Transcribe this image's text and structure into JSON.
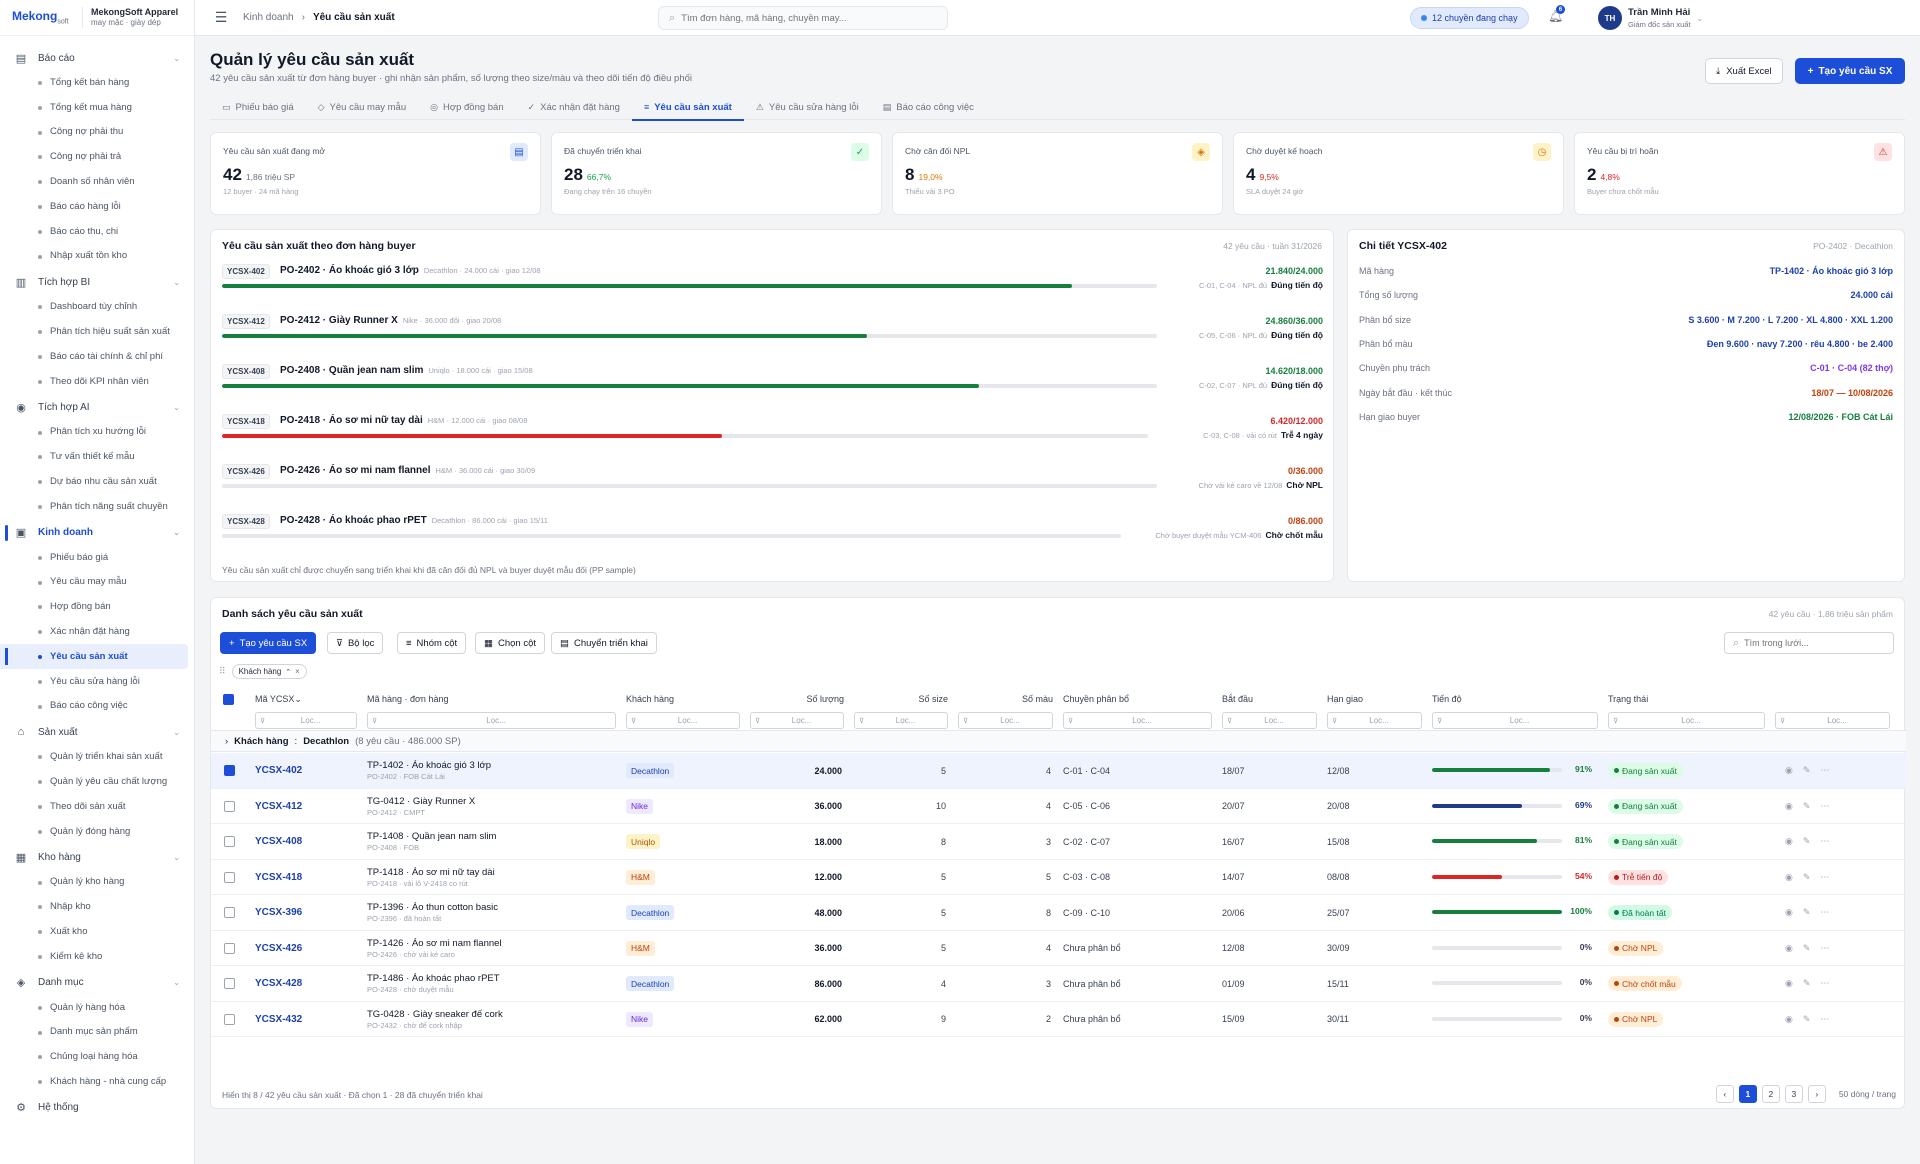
{
  "brand": {
    "logo": "Mekong",
    "logo_sub": "soft",
    "company": "MekongSoft Apparel",
    "tagline": "may mặc · giày dép"
  },
  "sidebar": {
    "groups": [
      {
        "label": "Báo cáo",
        "icon": "report-icon",
        "items": [
          "Tổng kết bán hàng",
          "Tổng kết mua hàng",
          "Công nợ phải thu",
          "Công nợ phải trả",
          "Doanh số nhân viên",
          "Báo cáo hàng lỗi",
          "Báo cáo thu, chi",
          "Nhập xuất tồn kho"
        ]
      },
      {
        "label": "Tích hợp BI",
        "icon": "chart-icon",
        "items": [
          "Dashboard tùy chỉnh",
          "Phân tích hiệu suất sản xuất",
          "Báo cáo tài chính & chỉ phí",
          "Theo dõi KPI nhân viên"
        ]
      },
      {
        "label": "Tích hợp AI",
        "icon": "ai-icon",
        "items": [
          "Phân tích xu hướng lỗi",
          "Tư vấn thiết kế mẫu",
          "Dự báo nhu cầu sản xuất",
          "Phân tích năng suất chuyền"
        ]
      },
      {
        "label": "Kinh doanh",
        "icon": "business-icon",
        "active": true,
        "items": [
          "Phiếu báo giá",
          "Yêu cầu may mẫu",
          "Hợp đồng bán",
          "Xác nhận đặt hàng",
          "Yêu cầu sản xuất",
          "Yêu cầu sửa hàng lỗi",
          "Báo cáo công việc"
        ],
        "active_item": 4
      },
      {
        "label": "Sản xuất",
        "icon": "factory-icon",
        "items": [
          "Quản lý triển khai sản xuất",
          "Quản lý yêu cầu chất lượng",
          "Theo dõi sản xuất",
          "Quản lý đóng hàng"
        ]
      },
      {
        "label": "Kho hàng",
        "icon": "warehouse-icon",
        "items": [
          "Quản lý kho hàng",
          "Nhập kho",
          "Xuất kho",
          "Kiểm kê kho"
        ]
      },
      {
        "label": "Danh mục",
        "icon": "catalog-icon",
        "items": [
          "Quản lý hàng hóa",
          "Danh mục sản phẩm",
          "Chủng loại hàng hóa",
          "Khách hàng - nhà cung cấp"
        ]
      },
      {
        "label": "Hệ thống",
        "icon": "settings-icon",
        "items": []
      }
    ]
  },
  "topbar": {
    "breadcrumb": [
      "Kinh doanh",
      "Yêu cầu sản xuất"
    ],
    "search_placeholder": "Tìm đơn hàng, mã hàng, chuyền may...",
    "lines_chip": "12 chuyền đang chạy",
    "notif_count": "6",
    "user_initials": "TH",
    "user_name": "Trần Minh Hải",
    "user_role": "Giám đốc sản xuất"
  },
  "page": {
    "title": "Quản lý yêu cầu sản xuất",
    "subtitle": "42 yêu cầu sản xuất từ đơn hàng buyer · ghi nhận sản phẩm, số lượng theo size/màu và theo dõi tiến độ điều phối",
    "export_label": "Xuất Excel",
    "create_label": "Tạo yêu cầu SX"
  },
  "tabs": [
    {
      "label": "Phiếu báo giá",
      "icon": "quote-icon"
    },
    {
      "label": "Yêu cầu may mẫu",
      "icon": "tag-icon"
    },
    {
      "label": "Hợp đồng bán",
      "icon": "contract-icon"
    },
    {
      "label": "Xác nhận đặt hàng",
      "icon": "check-circle-icon"
    },
    {
      "label": "Yêu cầu sản xuất",
      "icon": "production-icon",
      "active": true
    },
    {
      "label": "Yêu cầu sửa hàng lỗi",
      "icon": "warning-icon"
    },
    {
      "label": "Báo cáo công việc",
      "icon": "document-icon"
    }
  ],
  "kpis": [
    {
      "label": "Yêu cầu sản xuất đang mở",
      "value": "42",
      "delta": "1,86 triệu SP",
      "foot": "12 buyer · 24 mã hàng",
      "icon": "document-icon",
      "color": "#1d4ed8",
      "bg": "#e0eafc",
      "delta_color": "#6b7280"
    },
    {
      "label": "Đã chuyển triển khai",
      "value": "28",
      "delta": "66,7%",
      "foot": "Đang chạy trên 16 chuyền",
      "icon": "check-circle-icon",
      "color": "#16a34a",
      "bg": "#dcfce7",
      "delta_color": "#16a34a"
    },
    {
      "label": "Chờ cân đối NPL",
      "value": "8",
      "delta": "19,0%",
      "foot": "Thiếu vải 3 PO",
      "icon": "box-icon",
      "color": "#d97706",
      "bg": "#fef3c7",
      "delta_color": "#d97706"
    },
    {
      "label": "Chờ duyệt kế hoạch",
      "value": "4",
      "delta": "9,5%",
      "foot": "SLA duyệt 24 giờ",
      "icon": "clock-icon",
      "color": "#d97706",
      "bg": "#fef3c7",
      "delta_color": "#dc2626"
    },
    {
      "label": "Yêu cầu bị trì hoãn",
      "value": "2",
      "delta": "4,8%",
      "foot": "Buyer chưa chốt mẫu",
      "icon": "alert-icon",
      "color": "#dc2626",
      "bg": "#fee2e2",
      "delta_color": "#dc2626"
    }
  ],
  "orders_panel": {
    "title": "Yêu cầu sản xuất theo đơn hàng buyer",
    "meta": "42 yêu cầu · tuần 31/2026",
    "footnote": "Yêu cầu sản xuất chỉ được chuyển sang triển khai khi đã cân đối đủ NPL và buyer duyệt mẫu đối (PP sample)",
    "orders": [
      {
        "code": "YCSX-402",
        "name": "PO-2402 · Áo khoác gió 3 lớp",
        "meta": "Decathlon · 24.000 cái · giao 12/08",
        "qty": "21.840/24.000",
        "progress": 0.91,
        "color": "#15803d",
        "note": "C-01, C-04 · NPL đủ",
        "status": "Đúng tiến độ"
      },
      {
        "code": "YCSX-412",
        "name": "PO-2412 · Giày Runner X",
        "meta": "Nike · 36.000 đôi · giao 20/08",
        "qty": "24.860/36.000",
        "progress": 0.69,
        "color": "#15803d",
        "note": "C-05, C-06 · NPL đủ",
        "status": "Đúng tiến độ"
      },
      {
        "code": "YCSX-408",
        "name": "PO-2408 · Quần jean nam slim",
        "meta": "Uniqlo · 18.000 cái · giao 15/08",
        "qty": "14.620/18.000",
        "progress": 0.81,
        "color": "#15803d",
        "note": "C-02, C-07 · NPL đủ",
        "status": "Đúng tiến độ"
      },
      {
        "code": "YCSX-418",
        "name": "PO-2418 · Áo sơ mi nữ tay dài",
        "meta": "H&M · 12.000 cái · giao 08/08",
        "qty": "6.420/12.000",
        "progress": 0.54,
        "color": "#dc2626",
        "note": "C-03, C-08 · vải có rút",
        "status": "Trễ 4 ngày"
      },
      {
        "code": "YCSX-426",
        "name": "PO-2426 · Áo sơ mi nam flannel",
        "meta": "H&M · 36.000 cái · giao 30/09",
        "qty": "0/36.000",
        "progress": 0,
        "color": "#c2410c",
        "note": "Chờ vải kẻ caro về 12/08",
        "status": "Chờ NPL"
      },
      {
        "code": "YCSX-428",
        "name": "PO-2428 · Áo khoác phao rPET",
        "meta": "Decathlon · 86.000 cái · giao 15/11",
        "qty": "0/86.000",
        "progress": 0,
        "color": "#c2410c",
        "note": "Chờ buyer duyệt mẫu YCM-406",
        "status": "Chờ chốt mẫu"
      }
    ]
  },
  "detail_panel": {
    "title": "Chi tiết YCSX-402",
    "meta": "PO-2402 · Decathlon",
    "rows": [
      {
        "k": "Mã hàng",
        "v": "TP-1402 · Áo khoác gió 3 lớp",
        "c": "#1e40af"
      },
      {
        "k": "Tổng số lượng",
        "v": "24.000 cái",
        "c": "#1e40af"
      },
      {
        "k": "Phân bổ size",
        "v": "S 3.600 · M 7.200 · L 7.200 · XL 4.800 · XXL 1.200",
        "c": "#1e40af"
      },
      {
        "k": "Phân bổ màu",
        "v": "Đen 9.600 · navy 7.200 · rêu 4.800 · be 2.400",
        "c": "#1e40af"
      },
      {
        "k": "Chuyền phụ trách",
        "v": "C-01 · C-04 (82 thợ)",
        "c": "#7c3aed"
      },
      {
        "k": "Ngày bắt đầu · kết thúc",
        "v": "18/07 — 10/08/2026",
        "c": "#c2410c"
      },
      {
        "k": "Hạn giao buyer",
        "v": "12/08/2026 · FOB Cát Lái",
        "c": "#15803d"
      }
    ]
  },
  "list": {
    "title": "Danh sách yêu cầu sản xuất",
    "meta": "42 yêu cầu · 1,86 triệu sản phẩm",
    "toolbar": [
      "Tạo yêu cầu SX",
      "Bộ lọc",
      "Nhóm cột",
      "Chọn cột",
      "Chuyển triển khai"
    ],
    "search_placeholder": "Tìm trong lưới...",
    "group_chip": "Khách hàng",
    "columns": [
      "Mã YCSX",
      "Mã hàng · đơn hàng",
      "Khách hàng",
      "Số lượng",
      "Số size",
      "Số màu",
      "Chuyền phân bổ",
      "Bắt đầu",
      "Hạn giao",
      "Tiến độ",
      "Trạng thái"
    ],
    "filter_placeholder": "Lọc...",
    "group_label": "Khách hàng",
    "group_value": "Decathlon",
    "group_count": "(8 yêu cầu · 486.000 SP)",
    "rows": [
      {
        "code": "YCSX-402",
        "product": "TP-1402 · Áo khoác gió 3 lớp",
        "order": "PO-2402 · FOB Cát Lái",
        "customer": "Decathlon",
        "qty": "24.000",
        "sizes": "5",
        "colors": "4",
        "lines": "C-01 · C-04",
        "start": "18/07",
        "due": "12/08",
        "progress": 0.91,
        "pct": "91%",
        "status": "Đang sản xuất",
        "selected": true
      },
      {
        "code": "YCSX-412",
        "product": "TG-0412 · Giày Runner X",
        "order": "PO-2412 · CMPT",
        "customer": "Nike",
        "qty": "36.000",
        "sizes": "10",
        "colors": "4",
        "lines": "C-05 · C-06",
        "start": "20/07",
        "due": "20/08",
        "progress": 0.69,
        "pct": "69%",
        "status": "Đang sản xuất"
      },
      {
        "code": "YCSX-408",
        "product": "TP-1408 · Quần jean nam slim",
        "order": "PO-2408 · FOB",
        "customer": "Uniqlo",
        "qty": "18.000",
        "sizes": "8",
        "colors": "3",
        "lines": "C-02 · C-07",
        "start": "16/07",
        "due": "15/08",
        "progress": 0.81,
        "pct": "81%",
        "status": "Đang sản xuất"
      },
      {
        "code": "YCSX-418",
        "product": "TP-1418 · Áo sơ mi nữ tay dài",
        "order": "PO-2418 · vải lô V-2418 co rút",
        "customer": "H&M",
        "qty": "12.000",
        "sizes": "5",
        "colors": "5",
        "lines": "C-03 · C-08",
        "start": "14/07",
        "due": "08/08",
        "progress": 0.54,
        "pct": "54%",
        "status": "Trễ tiến độ"
      },
      {
        "code": "YCSX-396",
        "product": "TP-1396 · Áo thun cotton basic",
        "order": "PO-2396 · đã hoàn tất",
        "customer": "Decathlon",
        "qty": "48.000",
        "sizes": "5",
        "colors": "8",
        "lines": "C-09 · C-10",
        "start": "20/06",
        "due": "25/07",
        "progress": 1,
        "pct": "100%",
        "status": "Đã hoàn tất"
      },
      {
        "code": "YCSX-426",
        "product": "TP-1426 · Áo sơ mi nam flannel",
        "order": "PO-2426 · chờ vải kẻ caro",
        "customer": "H&M",
        "qty": "36.000",
        "sizes": "5",
        "colors": "4",
        "lines": "Chưa phân bổ",
        "start": "12/08",
        "due": "30/09",
        "progress": 0,
        "pct": "0%",
        "status": "Chờ NPL"
      },
      {
        "code": "YCSX-428",
        "product": "TP-1486 · Áo khoác phao rPET",
        "order": "PO-2428 · chờ duyệt mẫu",
        "customer": "Decathlon",
        "qty": "86.000",
        "sizes": "4",
        "colors": "3",
        "lines": "Chưa phân bổ",
        "start": "01/09",
        "due": "15/11",
        "progress": 0,
        "pct": "0%",
        "status": "Chờ chốt mẫu"
      },
      {
        "code": "YCSX-432",
        "product": "TG-0428 · Giày sneaker đế cork",
        "order": "PO-2432 · chờ đế cork nhập",
        "customer": "Nike",
        "qty": "62.000",
        "sizes": "9",
        "colors": "2",
        "lines": "Chưa phân bổ",
        "start": "15/09",
        "due": "30/11",
        "progress": 0,
        "pct": "0%",
        "status": "Chờ NPL"
      }
    ],
    "footer": "Hiển thị 8 / 42 yêu cầu sản xuất · Đã chọn 1 · 28 đã chuyển triển khai",
    "pages": [
      "‹",
      "1",
      "2",
      "3",
      "›"
    ],
    "page_size": "50 dòng / trang"
  }
}
